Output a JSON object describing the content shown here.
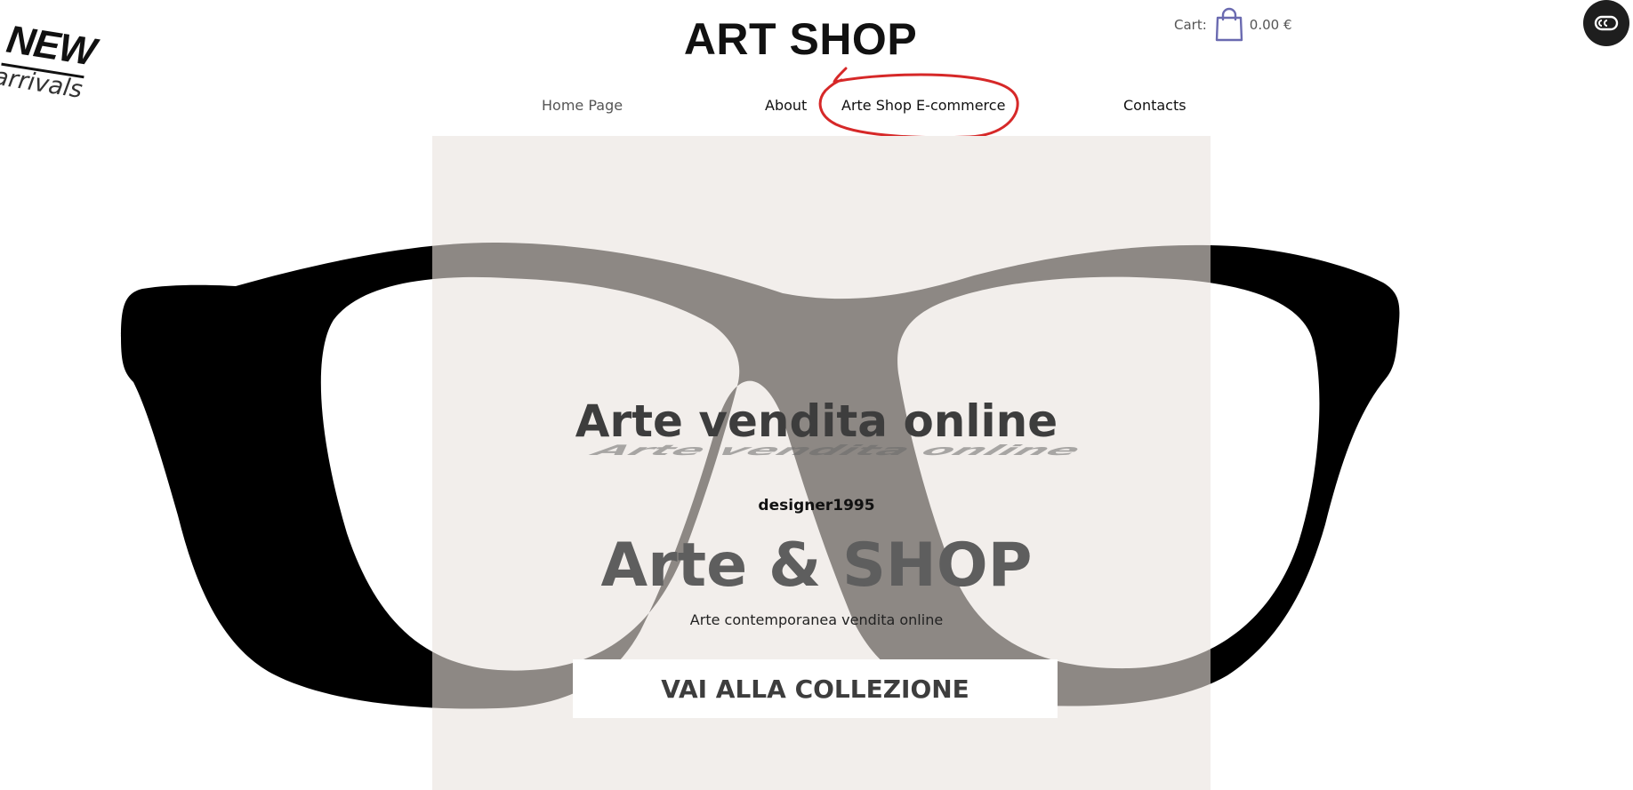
{
  "badge": {
    "line1": "NEW",
    "line2": "arrivals"
  },
  "header": {
    "logo": "ART SHOP"
  },
  "cart": {
    "label": "Cart:",
    "amount": "0.00 €",
    "icon": "shopping-bag-icon",
    "icon_color": "#6a6ab0"
  },
  "chat_button": {
    "icon": "chat-bubble-icon"
  },
  "nav": {
    "items": [
      {
        "label": "Home Page",
        "state": "current"
      },
      {
        "label": "About"
      },
      {
        "label": "Arte Shop E-commerce",
        "annotated": true
      },
      {
        "label": "Contacts"
      }
    ],
    "annotation_color": "#d62828"
  },
  "hero": {
    "title": "Arte vendita online",
    "designer": "designer1995",
    "brand": "Arte & SHOP",
    "tagline": "Arte contemporanea vendita online",
    "cta": "VAI ALLA COLLEZIONE"
  },
  "colors": {
    "panel": "#f2eeeb",
    "frame": "#000000",
    "frame_overlay": "#8d8884"
  }
}
